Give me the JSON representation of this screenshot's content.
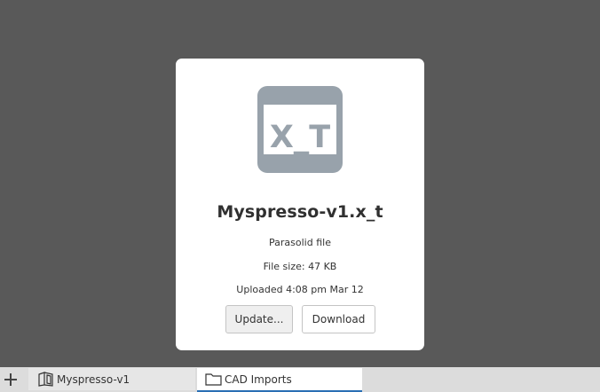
{
  "file": {
    "icon_label": "X_T",
    "name": "Myspresso-v1.x_t",
    "type": "Parasolid file",
    "size": "File size: 47 KB",
    "uploaded": "Uploaded 4:08 pm Mar 12"
  },
  "actions": {
    "update_label": "Update...",
    "download_label": "Download"
  },
  "tabbar": {
    "tabs": [
      {
        "label": "Myspresso-v1",
        "icon": "part-studio-icon",
        "active": false
      },
      {
        "label": "CAD Imports",
        "icon": "folder-icon",
        "active": true
      }
    ]
  },
  "colors": {
    "background": "#595959",
    "icon_gray": "#98a2ab",
    "active_tab_underline": "#2a6fb4"
  }
}
